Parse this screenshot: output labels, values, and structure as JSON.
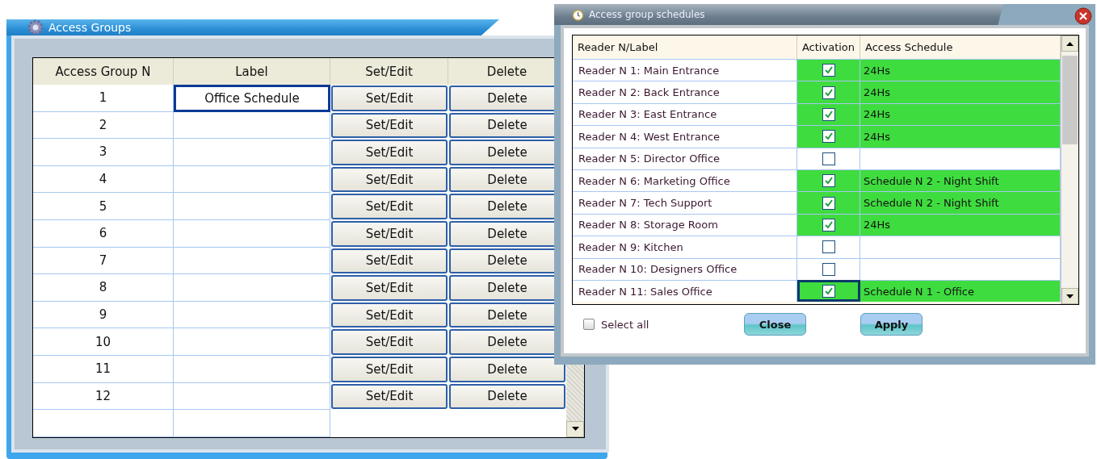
{
  "access_groups": {
    "title": "Access Groups",
    "columns": [
      "Access Group N",
      "Label",
      "Set/Edit",
      "Delete"
    ],
    "rows": [
      {
        "number": "1",
        "label": "Office Schedule",
        "selected": true,
        "edit": "Set/Edit",
        "delete": "Delete"
      },
      {
        "number": "2",
        "selected": false,
        "edit": "Set/Edit",
        "delete": "Delete"
      },
      {
        "number": "3",
        "selected": false,
        "edit": "Set/Edit",
        "delete": "Delete"
      },
      {
        "number": "4",
        "selected": false,
        "edit": "Set/Edit",
        "delete": "Delete"
      },
      {
        "number": "5",
        "selected": false,
        "edit": "Set/Edit",
        "delete": "Delete"
      },
      {
        "number": "6",
        "selected": false,
        "edit": "Set/Edit",
        "delete": "Delete"
      },
      {
        "number": "7",
        "selected": false,
        "edit": "Set/Edit",
        "delete": "Delete"
      },
      {
        "number": "8",
        "selected": false,
        "edit": "Set/Edit",
        "delete": "Delete"
      },
      {
        "number": "9",
        "selected": false,
        "edit": "Set/Edit",
        "delete": "Delete"
      },
      {
        "number": "10",
        "selected": false,
        "edit": "Set/Edit",
        "delete": "Delete"
      },
      {
        "number": "11",
        "selected": false,
        "edit": "Set/Edit",
        "delete": "Delete"
      },
      {
        "number": "12",
        "selected": false,
        "edit": "Set/Edit",
        "delete": "Delete"
      }
    ]
  },
  "schedules_dialog": {
    "title": "Access group schedules",
    "columns": [
      "Reader N/Label",
      "Activation",
      "Access Schedule"
    ],
    "readers": [
      {
        "label": "Reader N 1: Main Entrance",
        "active": true,
        "schedule": "24Hs",
        "selected": false
      },
      {
        "label": "Reader N 2: Back Entrance",
        "active": true,
        "schedule": "24Hs",
        "selected": false
      },
      {
        "label": "Reader N 3: East Entrance",
        "active": true,
        "schedule": "24Hs",
        "selected": false
      },
      {
        "label": "Reader N 4: West Entrance",
        "active": true,
        "schedule": "24Hs",
        "selected": false
      },
      {
        "label": "Reader N 5: Director Office",
        "active": false,
        "selected": false
      },
      {
        "label": "Reader N 6: Marketing Office",
        "active": true,
        "schedule": "Schedule N 2 - Night Shift",
        "selected": false
      },
      {
        "label": "Reader N 7: Tech Support",
        "active": true,
        "schedule": "Schedule N 2 - Night Shift",
        "selected": false
      },
      {
        "label": "Reader N 8: Storage Room",
        "active": true,
        "schedule": "24Hs",
        "selected": false
      },
      {
        "label": "Reader N 9: Kitchen",
        "active": false,
        "selected": false
      },
      {
        "label": "Reader N 10: Designers Office",
        "active": false,
        "selected": false
      },
      {
        "label": "Reader N 11: Sales Office",
        "active": true,
        "schedule": "Schedule N 1 - Office",
        "selected": true
      }
    ],
    "select_all": {
      "label": "Select all",
      "checked": false
    },
    "buttons": [
      "Close",
      "Apply"
    ]
  }
}
